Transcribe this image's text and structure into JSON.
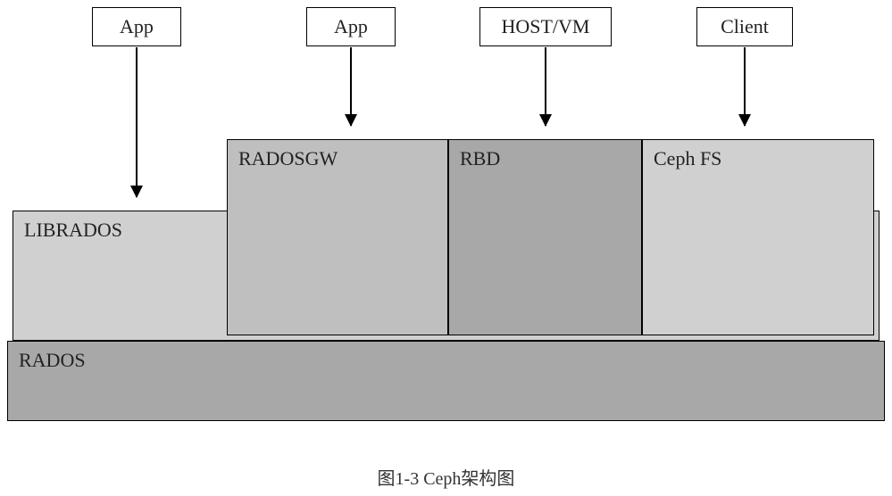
{
  "top_boxes": [
    {
      "label": "App"
    },
    {
      "label": "App"
    },
    {
      "label": "HOST/VM"
    },
    {
      "label": "Client"
    }
  ],
  "layers": {
    "librados": "LIBRADOS",
    "radosgw": "RADOSGW",
    "rbd": "RBD",
    "cephfs": "Ceph FS",
    "rados": "RADOS"
  },
  "caption": "图1-3    Ceph架构图"
}
